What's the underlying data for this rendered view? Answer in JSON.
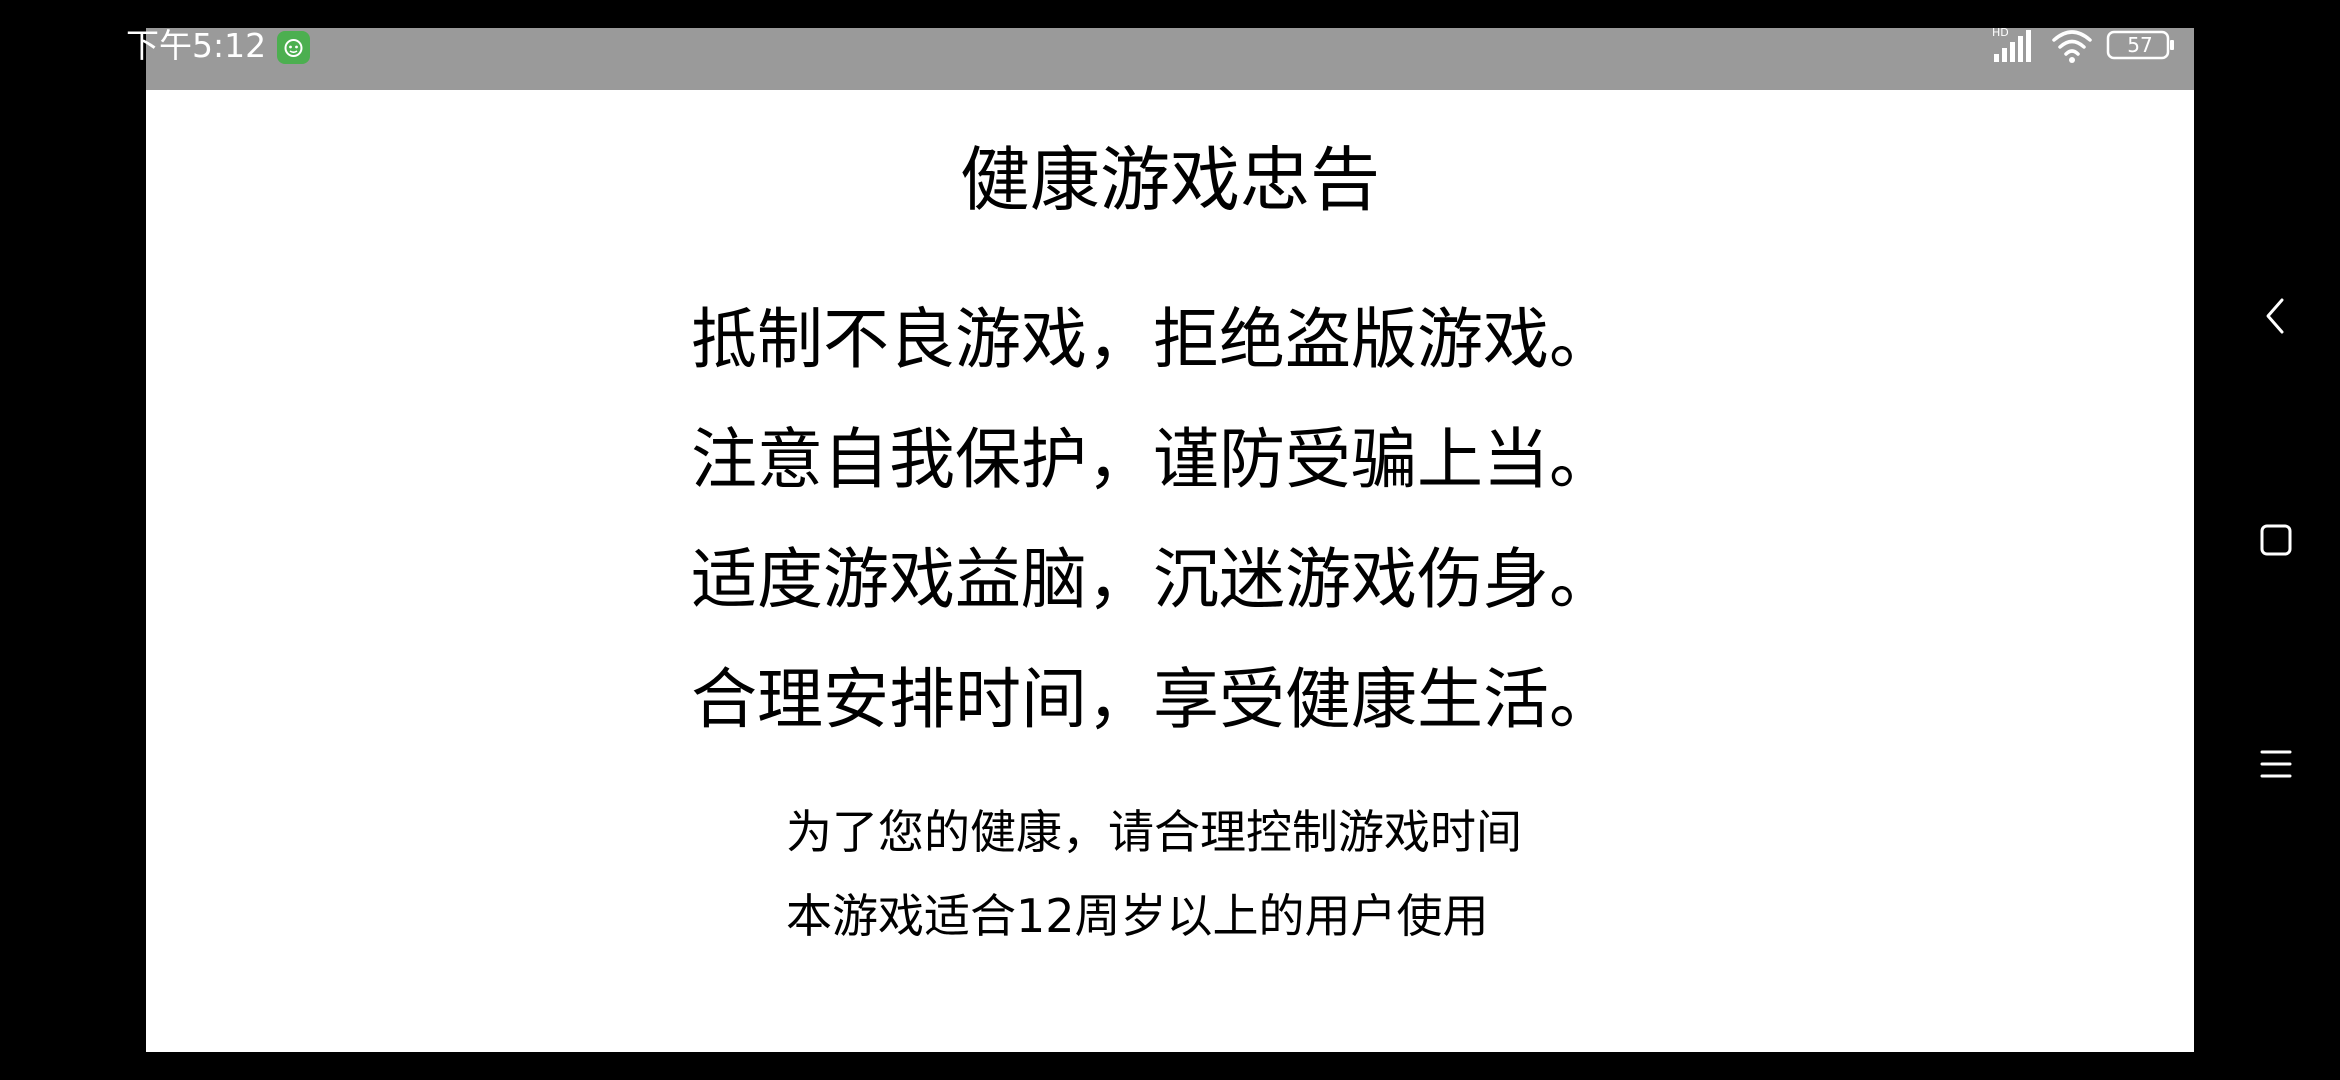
{
  "status_bar": {
    "time": "下午5:12",
    "notification_icon": "android-robot-icon",
    "signal_icon": "hd-signal-icon",
    "wifi_icon": "wifi-icon",
    "battery_level": "57",
    "background_color": "#9a9a9a"
  },
  "notice": {
    "title": "健康游戏忠告",
    "lines": [
      "抵制不良游戏，拒绝盗版游戏。",
      "注意自我保护，谨防受骗上当。",
      "适度游戏益脑，沉迷游戏伤身。",
      "合理安排时间，享受健康生活。"
    ],
    "footer": [
      "为了您的健康，请合理控制游戏时间",
      "本游戏适合12周岁以上的用户使用"
    ]
  },
  "navigation": {
    "back_icon": "chevron-left-icon",
    "home_icon": "square-icon",
    "menu_icon": "hamburger-icon"
  }
}
